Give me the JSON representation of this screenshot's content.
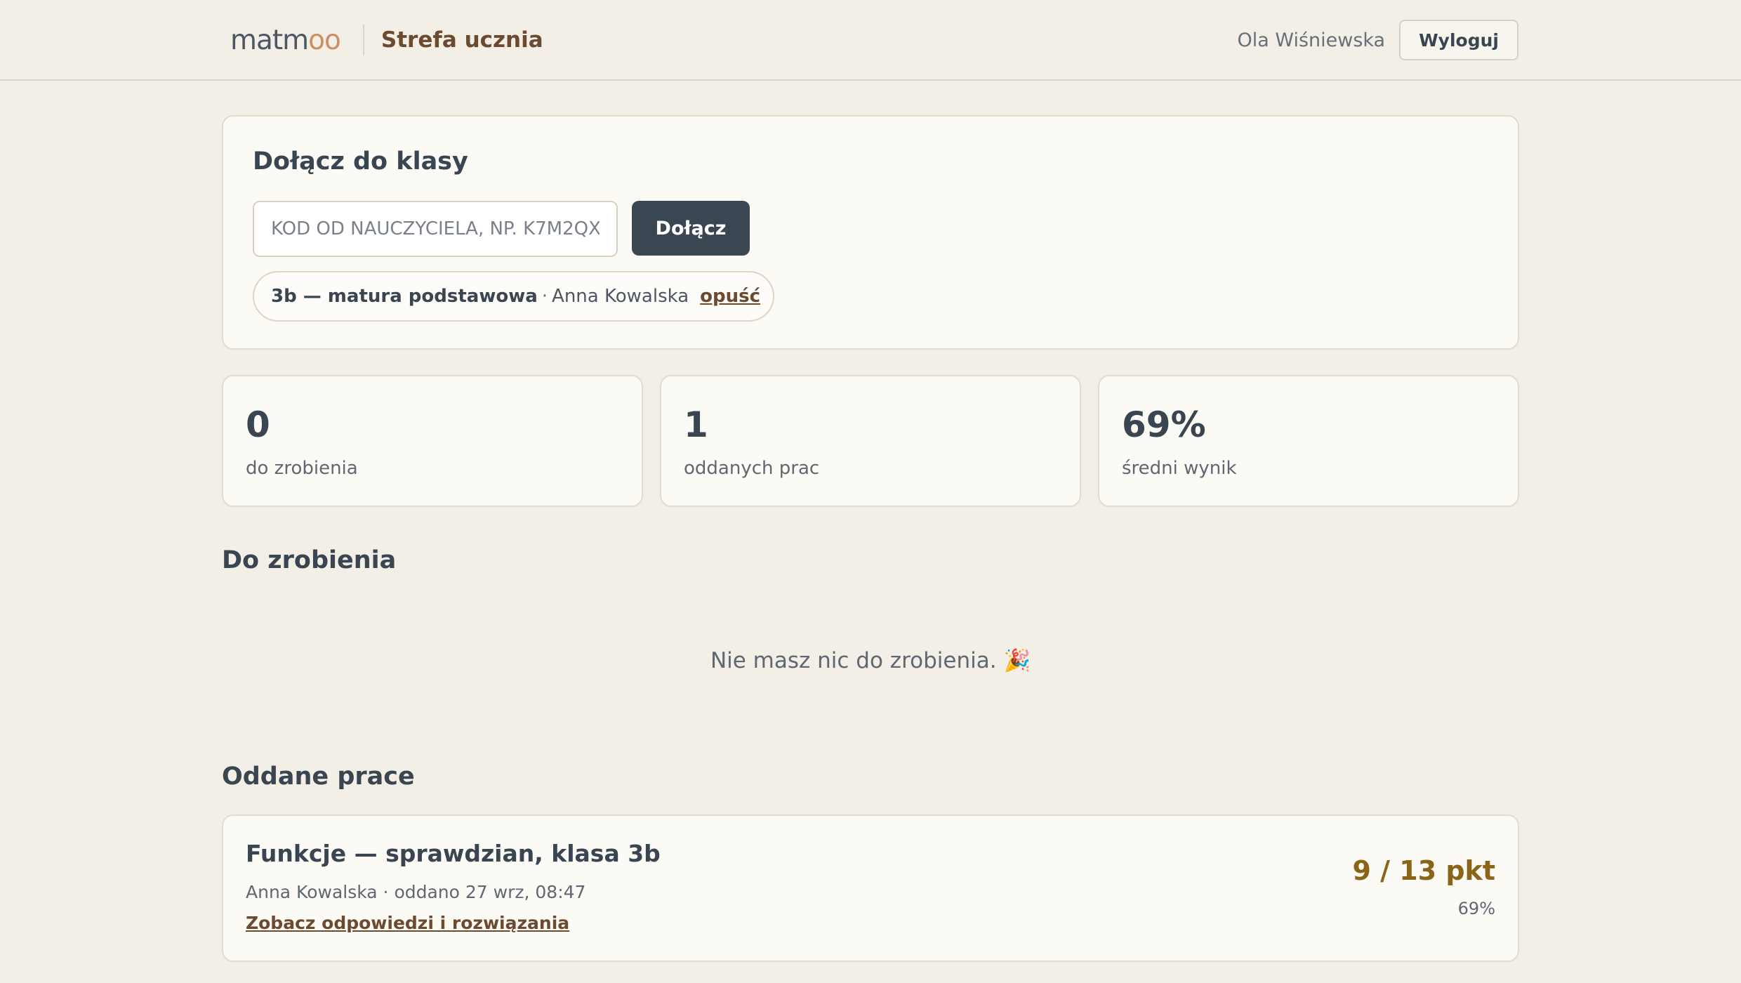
{
  "header": {
    "logo_main": "matm",
    "logo_accent": "oo",
    "zone_title": "Strefa ucznia",
    "user_name": "Ola Wiśniewska",
    "logout_label": "Wyloguj"
  },
  "join": {
    "title": "Dołącz do klasy",
    "code_placeholder": "KOD OD NAUCZYCIELA, NP. K7M2QX",
    "code_value": "",
    "join_label": "Dołącz",
    "class_name": "3b — matura podstawowa",
    "separator": "·",
    "teacher": "Anna Kowalska",
    "leave_label": "opuść"
  },
  "stats": [
    {
      "value": "0",
      "label": "do zrobienia"
    },
    {
      "value": "1",
      "label": "oddanych prac"
    },
    {
      "value": "69%",
      "label": "średni wynik"
    }
  ],
  "todo": {
    "title": "Do zrobienia",
    "empty_message": "Nie masz nic do zrobienia. 🎉"
  },
  "submitted": {
    "title": "Oddane prace",
    "items": [
      {
        "title": "Funkcje — sprawdzian, klasa 3b",
        "meta": "Anna Kowalska · oddano 27 wrz, 08:47",
        "link_label": "Zobacz odpowiedzi i rozwiązania",
        "score": "9 / 13 pkt",
        "percent": "69%"
      }
    ]
  },
  "colors": {
    "background": "#f3efe6",
    "card": "#fbfaf5",
    "primary_button": "#3b4653",
    "brand_brown": "#6b4a2f",
    "score_gold": "#8a6417",
    "logo_accent": "#c98f66"
  }
}
